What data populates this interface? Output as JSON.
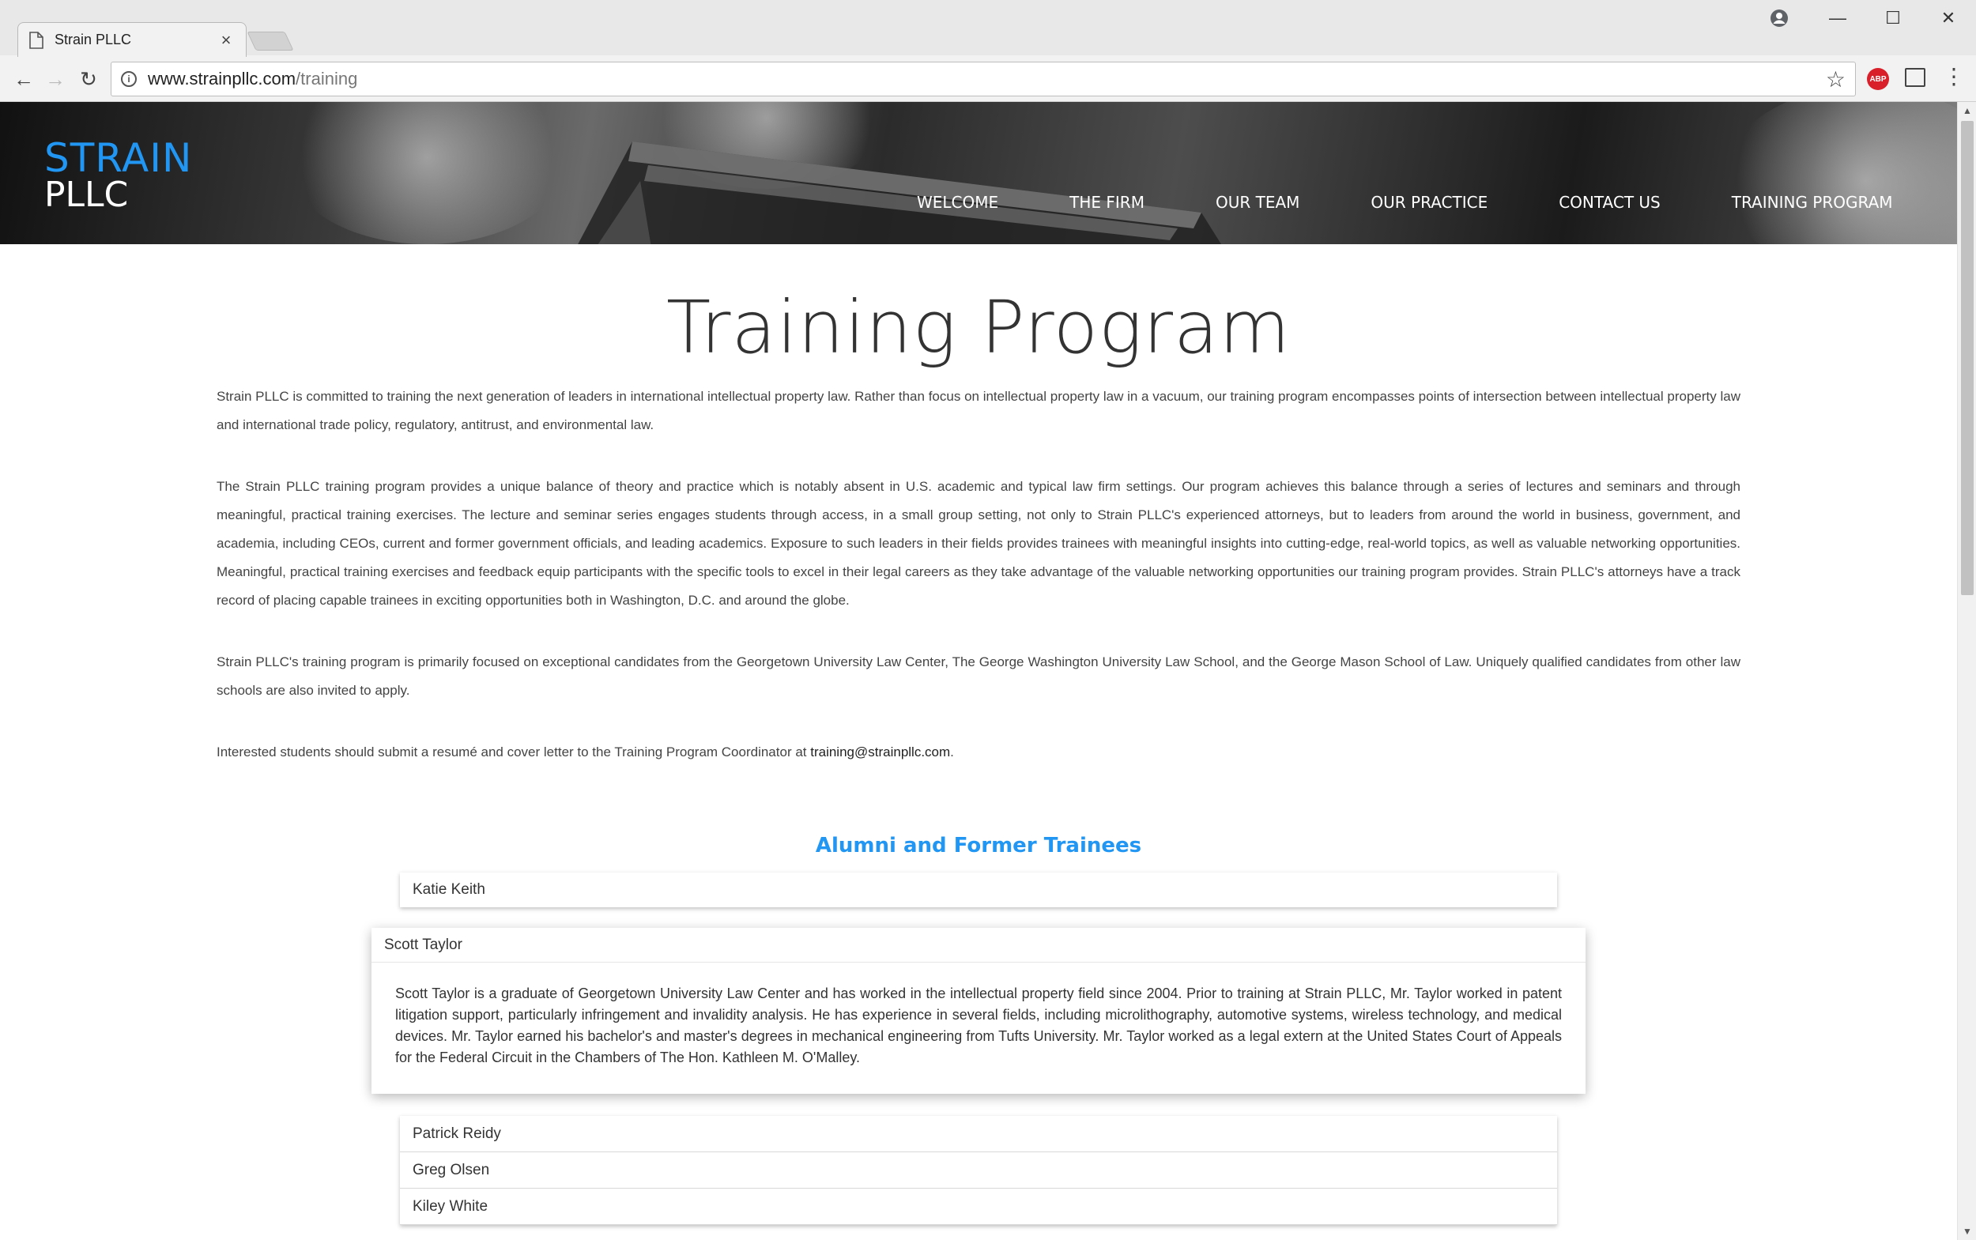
{
  "browser": {
    "tab_title": "Strain PLLC",
    "tab_close": "×",
    "url_host": "www.strainpllc.com",
    "url_path": "/training",
    "back": "←",
    "forward": "→",
    "reload": "↻",
    "star": "☆",
    "abp": "ABP",
    "menu": "⋮",
    "minimize": "—",
    "maximize": "☐",
    "close": "✕"
  },
  "site": {
    "logo_line1": "STRAIN",
    "logo_line2": "PLLC",
    "nav": [
      "WELCOME",
      "THE FIRM",
      "OUR TEAM",
      "OUR PRACTICE",
      "CONTACT US",
      "TRAINING PROGRAM"
    ]
  },
  "page": {
    "title": "Training Program",
    "paragraphs": [
      "Strain PLLC is committed to training the next generation of leaders in international intellectual property law. Rather than focus on intellectual property law in a vacuum, our training program encompasses points of intersection between intellectual property law and international trade policy, regulatory, antitrust, and environmental law.",
      "The Strain PLLC training program provides a unique balance of theory and practice which is notably absent in U.S. academic and typical law firm settings. Our program achieves this balance through a series of lectures and seminars and through meaningful, practical training exercises. The lecture and seminar series engages students through access, in a small group setting, not only to Strain PLLC's experienced attorneys, but to leaders from around the world in business, government, and academia, including CEOs, current and former government officials, and leading academics. Exposure to such leaders in their fields provides trainees with meaningful insights into cutting-edge, real-world topics, as well as valuable networking opportunities. Meaningful, practical training exercises and feedback equip participants with the specific tools to excel in their legal careers as they take advantage of the valuable networking opportunities our training program provides. Strain PLLC's attorneys have a track record of placing capable trainees in exciting opportunities both in Washington, D.C. and around the globe.",
      "Strain PLLC's training program is primarily focused on exceptional candidates from the Georgetown University Law Center, The George Washington University Law School, and the George Mason School of Law. Uniquely qualified candidates from other law schools are also invited to apply."
    ],
    "apply_text": "Interested students should submit a resumé and cover letter to the Training Program Coordinator at ",
    "apply_email": "training@strainpllc.com",
    "apply_end": ".",
    "alumni_title": "Alumni and Former Trainees",
    "alumni": {
      "first": "Katie Keith",
      "open_name": "Scott Taylor",
      "open_bio": "Scott Taylor is a graduate of Georgetown University Law Center and has worked in the intellectual property field since 2004. Prior to training at Strain PLLC, Mr. Taylor worked in patent litigation support, particularly infringement and invalidity analysis. He has experience in several fields, including microlithography, automotive systems, wireless technology, and medical devices. Mr. Taylor earned his bachelor's and master's degrees in mechanical engineering from Tufts University. Mr. Taylor worked as a legal extern at the United States Court of Appeals for the Federal Circuit in the Chambers of The Hon. Kathleen M. O'Malley.",
      "rest": [
        "Patrick Reidy",
        "Greg Olsen",
        "Kiley White"
      ]
    }
  }
}
